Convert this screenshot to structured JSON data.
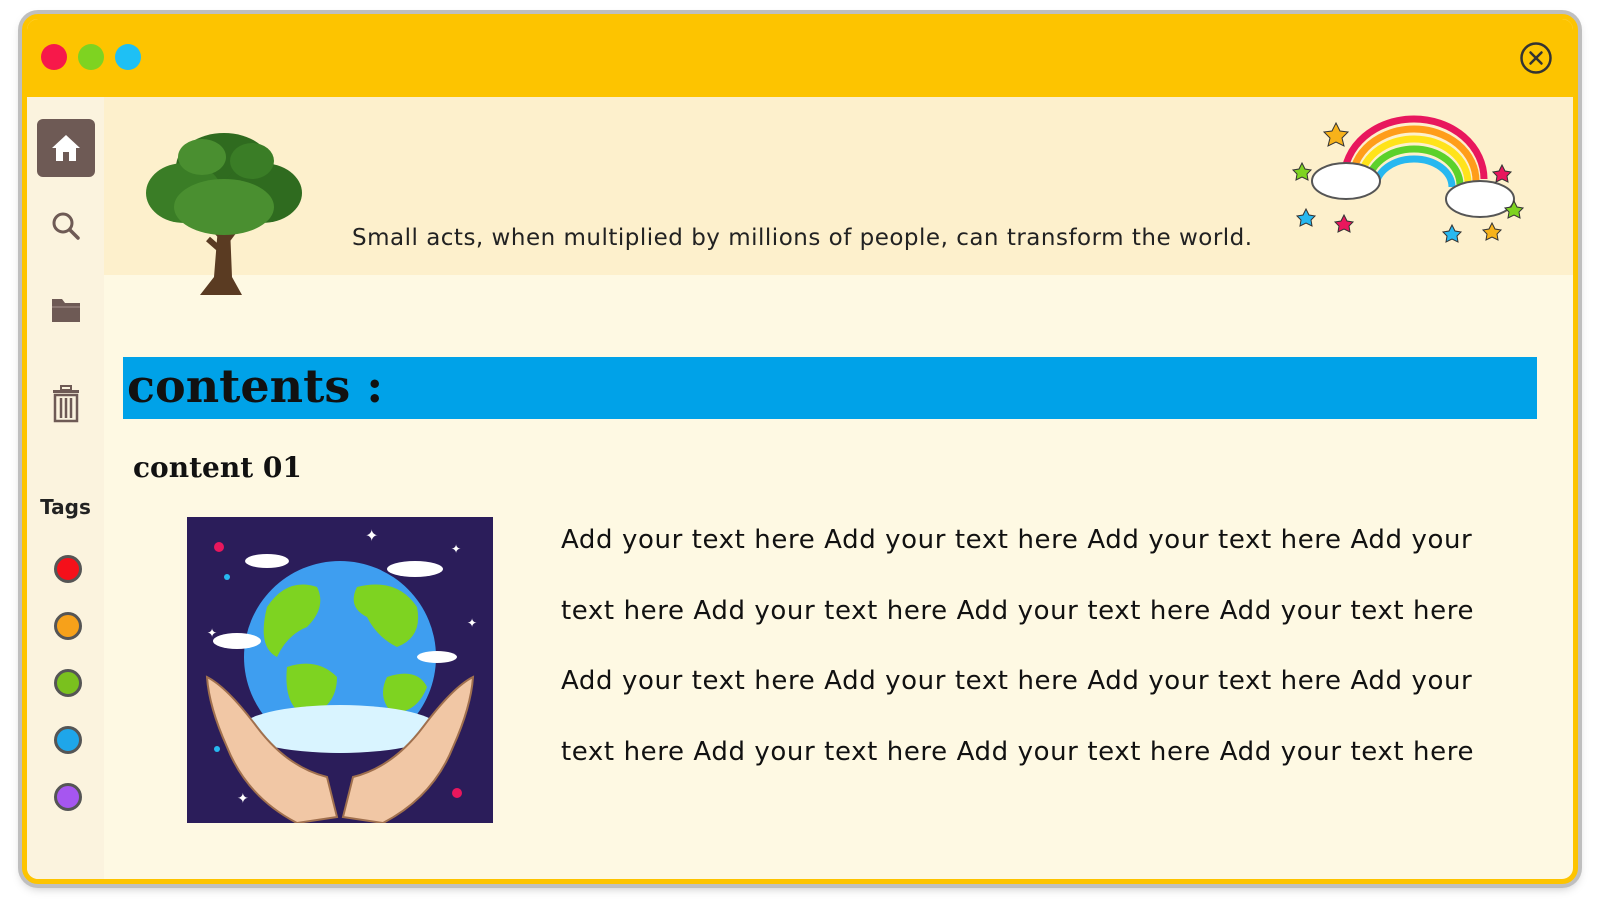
{
  "window": {
    "controls": [
      "close-red",
      "minimize-green",
      "maximize-blue"
    ],
    "accent_color": "#fdc400"
  },
  "sidebar": {
    "items": [
      {
        "name": "home",
        "icon": "home-icon",
        "active": true
      },
      {
        "name": "search",
        "icon": "search-icon",
        "active": false
      },
      {
        "name": "folder",
        "icon": "folder-icon",
        "active": false
      },
      {
        "name": "trash",
        "icon": "trash-icon",
        "active": false
      }
    ],
    "tags_label": "Tags",
    "tags": [
      {
        "color": "#f5101a"
      },
      {
        "color": "#f7a11a"
      },
      {
        "color": "#7ac11e"
      },
      {
        "color": "#1ea6ea"
      },
      {
        "color": "#a656f0"
      }
    ]
  },
  "banner": {
    "quote": "Small acts, when multiplied by millions of people, can transform the world."
  },
  "main": {
    "contents_title": "contents :",
    "section_title": "content 01",
    "body_text": "Add your text here Add your text here Add your text here Add your text here Add your text here Add your text here Add your text here Add your text here Add your text here Add your text here Add your text here Add your text here Add your text here Add your text here"
  }
}
